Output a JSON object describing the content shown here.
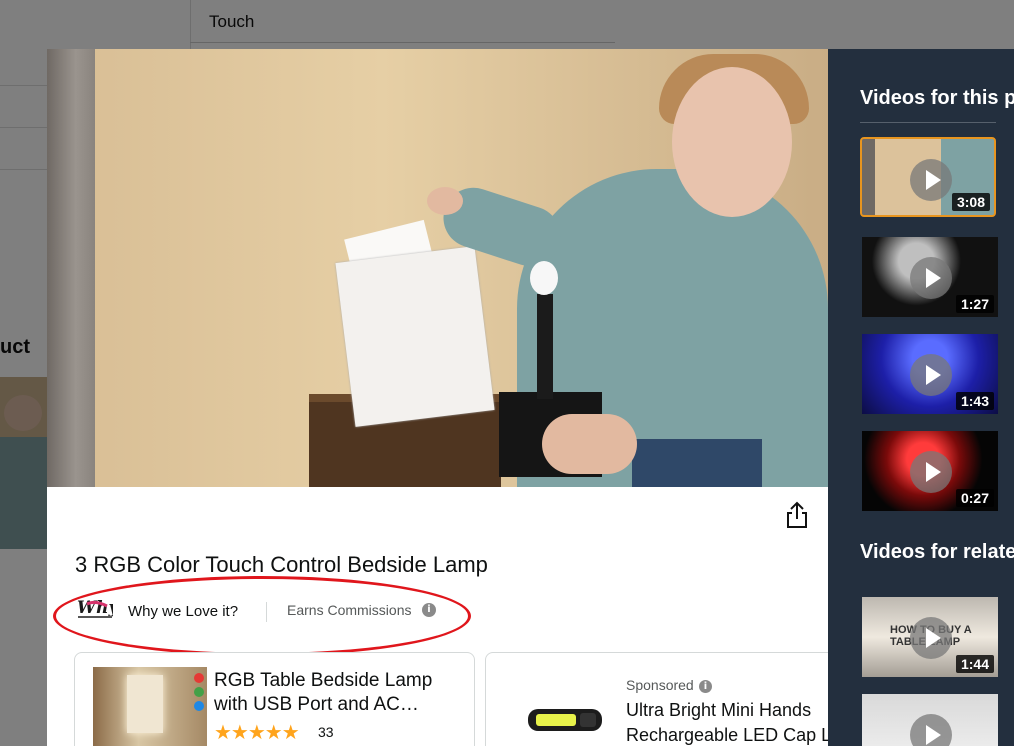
{
  "background": {
    "top_field_text": "Touch",
    "section_heading_fragment": "uct"
  },
  "video_player": {
    "share_icon": "share-icon"
  },
  "product": {
    "title": "3 RGB Color Touch Control Bedside Lamp",
    "brand_logo": "Why",
    "brand_tagline": "Why we Love it?",
    "commission_label": "Earns Commissions",
    "info_icon": "info-icon"
  },
  "product_cards": [
    {
      "title_line1": "RGB Table Bedside Lamp",
      "title_line2": "with USB Port and AC…",
      "stars": "★★★★★",
      "rating_count": "33"
    },
    {
      "sponsored_label": "Sponsored",
      "title_line1": "Ultra Bright Mini Hands",
      "title_line2": "Rechargeable LED Cap L"
    }
  ],
  "sidebar": {
    "heading_product": "Videos for this p",
    "heading_related": "Videos for relate",
    "product_videos": [
      {
        "duration": "3:08",
        "active": true
      },
      {
        "duration": "1:27",
        "active": false
      },
      {
        "duration": "1:43",
        "active": false
      },
      {
        "duration": "0:27",
        "active": false
      }
    ],
    "related_videos": [
      {
        "duration": "1:44",
        "label": "HOW TO BUY A TABLE LAMP"
      },
      {
        "duration": "",
        "label": ""
      }
    ]
  },
  "colors": {
    "sidebar_bg": "#232f3e",
    "active_border": "#e8951f",
    "annotation_red": "#e0161c",
    "star": "#ffa41c"
  }
}
